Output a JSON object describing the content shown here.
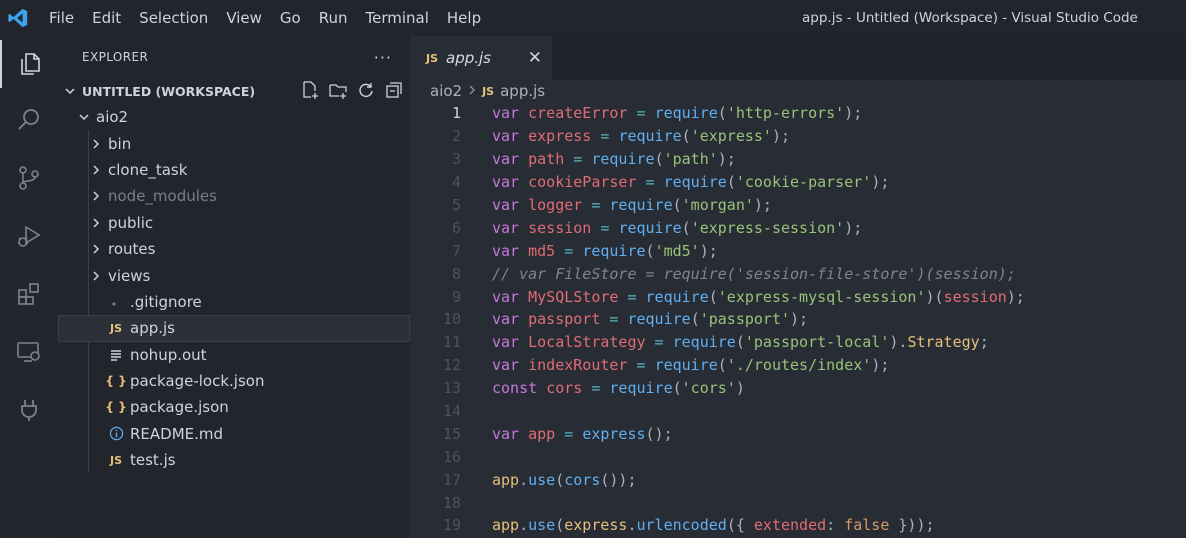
{
  "window_title": "app.js - Untitled (Workspace) - Visual Studio Code",
  "menu": [
    "File",
    "Edit",
    "Selection",
    "View",
    "Go",
    "Run",
    "Terminal",
    "Help"
  ],
  "explorer": {
    "title": "EXPLORER",
    "more": "···",
    "workspace": "UNTITLED (WORKSPACE)",
    "root": "aio2",
    "items": [
      {
        "label": "bin",
        "type": "folder"
      },
      {
        "label": "clone_task",
        "type": "folder"
      },
      {
        "label": "node_modules",
        "type": "folder",
        "dim": true
      },
      {
        "label": "public",
        "type": "folder"
      },
      {
        "label": "routes",
        "type": "folder"
      },
      {
        "label": "views",
        "type": "folder"
      },
      {
        "label": ".gitignore",
        "type": "gitignore"
      },
      {
        "label": "app.js",
        "type": "js",
        "selected": true
      },
      {
        "label": "nohup.out",
        "type": "text"
      },
      {
        "label": "package-lock.json",
        "type": "json"
      },
      {
        "label": "package.json",
        "type": "json"
      },
      {
        "label": "README.md",
        "type": "info"
      },
      {
        "label": "test.js",
        "type": "js"
      }
    ]
  },
  "editor": {
    "tab_label": "app.js",
    "tab_close": "✕",
    "breadcrumb": [
      "aio2",
      "app.js"
    ],
    "js_badge": "JS",
    "json_badge": "{ }",
    "line_numbers": [
      "1",
      "2",
      "3",
      "4",
      "5",
      "6",
      "7",
      "8",
      "9",
      "10",
      "11",
      "12",
      "13",
      "14",
      "15",
      "16",
      "17",
      "18",
      "19"
    ],
    "lines": [
      [
        [
          "kw",
          "var "
        ],
        [
          "var",
          "createError"
        ],
        [
          "op",
          " = "
        ],
        [
          "fn",
          "require"
        ],
        [
          "pun",
          "("
        ],
        [
          "str",
          "'http-errors'"
        ],
        [
          "pun",
          ");"
        ]
      ],
      [
        [
          "kw",
          "var "
        ],
        [
          "var",
          "express"
        ],
        [
          "op",
          " = "
        ],
        [
          "fn",
          "require"
        ],
        [
          "pun",
          "("
        ],
        [
          "str",
          "'express'"
        ],
        [
          "pun",
          ");"
        ]
      ],
      [
        [
          "kw",
          "var "
        ],
        [
          "var",
          "path"
        ],
        [
          "op",
          " = "
        ],
        [
          "fn",
          "require"
        ],
        [
          "pun",
          "("
        ],
        [
          "str",
          "'path'"
        ],
        [
          "pun",
          ");"
        ]
      ],
      [
        [
          "kw",
          "var "
        ],
        [
          "var",
          "cookieParser"
        ],
        [
          "op",
          " = "
        ],
        [
          "fn",
          "require"
        ],
        [
          "pun",
          "("
        ],
        [
          "str",
          "'cookie-parser'"
        ],
        [
          "pun",
          ");"
        ]
      ],
      [
        [
          "kw",
          "var "
        ],
        [
          "var",
          "logger"
        ],
        [
          "op",
          " = "
        ],
        [
          "fn",
          "require"
        ],
        [
          "pun",
          "("
        ],
        [
          "str",
          "'morgan'"
        ],
        [
          "pun",
          ");"
        ]
      ],
      [
        [
          "kw",
          "var "
        ],
        [
          "var",
          "session"
        ],
        [
          "op",
          " = "
        ],
        [
          "fn",
          "require"
        ],
        [
          "pun",
          "("
        ],
        [
          "str",
          "'express-session'"
        ],
        [
          "pun",
          ");"
        ]
      ],
      [
        [
          "kw",
          "var "
        ],
        [
          "var",
          "md5"
        ],
        [
          "op",
          " = "
        ],
        [
          "fn",
          "require"
        ],
        [
          "pun",
          "("
        ],
        [
          "str",
          "'md5'"
        ],
        [
          "pun",
          ");"
        ]
      ],
      [
        [
          "cm",
          "// var FileStore = require('session-file-store')(session);"
        ]
      ],
      [
        [
          "kw",
          "var "
        ],
        [
          "var",
          "MySQLStore"
        ],
        [
          "op",
          " = "
        ],
        [
          "fn",
          "require"
        ],
        [
          "pun",
          "("
        ],
        [
          "str",
          "'express-mysql-session'"
        ],
        [
          "pun",
          ")("
        ],
        [
          "var",
          "session"
        ],
        [
          "pun",
          ");"
        ]
      ],
      [
        [
          "kw",
          "var "
        ],
        [
          "var",
          "passport"
        ],
        [
          "op",
          " = "
        ],
        [
          "fn",
          "require"
        ],
        [
          "pun",
          "("
        ],
        [
          "str",
          "'passport'"
        ],
        [
          "pun",
          ");"
        ]
      ],
      [
        [
          "kw",
          "var "
        ],
        [
          "var",
          "LocalStrategy"
        ],
        [
          "op",
          " = "
        ],
        [
          "fn",
          "require"
        ],
        [
          "pun",
          "("
        ],
        [
          "str",
          "'passport-local'"
        ],
        [
          "pun",
          ")."
        ],
        [
          "cls",
          "Strategy"
        ],
        [
          "pun",
          ";"
        ]
      ],
      [
        [
          "kw",
          "var "
        ],
        [
          "var",
          "indexRouter"
        ],
        [
          "op",
          " = "
        ],
        [
          "fn",
          "require"
        ],
        [
          "pun",
          "("
        ],
        [
          "str",
          "'./routes/index'"
        ],
        [
          "pun",
          ");"
        ]
      ],
      [
        [
          "kw",
          "const "
        ],
        [
          "var",
          "cors"
        ],
        [
          "op",
          " = "
        ],
        [
          "fn",
          "require"
        ],
        [
          "pun",
          "("
        ],
        [
          "str",
          "'cors'"
        ],
        [
          "pun",
          ")"
        ]
      ],
      [],
      [
        [
          "kw",
          "var "
        ],
        [
          "var",
          "app"
        ],
        [
          "op",
          " = "
        ],
        [
          "fn",
          "express"
        ],
        [
          "pun",
          "();"
        ]
      ],
      [],
      [
        [
          "cls",
          "app"
        ],
        [
          "pun",
          "."
        ],
        [
          "fn",
          "use"
        ],
        [
          "pun",
          "("
        ],
        [
          "fn",
          "cors"
        ],
        [
          "pun",
          "());"
        ]
      ],
      [],
      [
        [
          "cls",
          "app"
        ],
        [
          "pun",
          "."
        ],
        [
          "fn",
          "use"
        ],
        [
          "pun",
          "("
        ],
        [
          "cls",
          "express"
        ],
        [
          "pun",
          "."
        ],
        [
          "fn",
          "urlencoded"
        ],
        [
          "pun",
          "({ "
        ],
        [
          "var",
          "extended"
        ],
        [
          "pun",
          ": "
        ],
        [
          "bool",
          "false"
        ],
        [
          "pun",
          " }));"
        ]
      ]
    ]
  }
}
